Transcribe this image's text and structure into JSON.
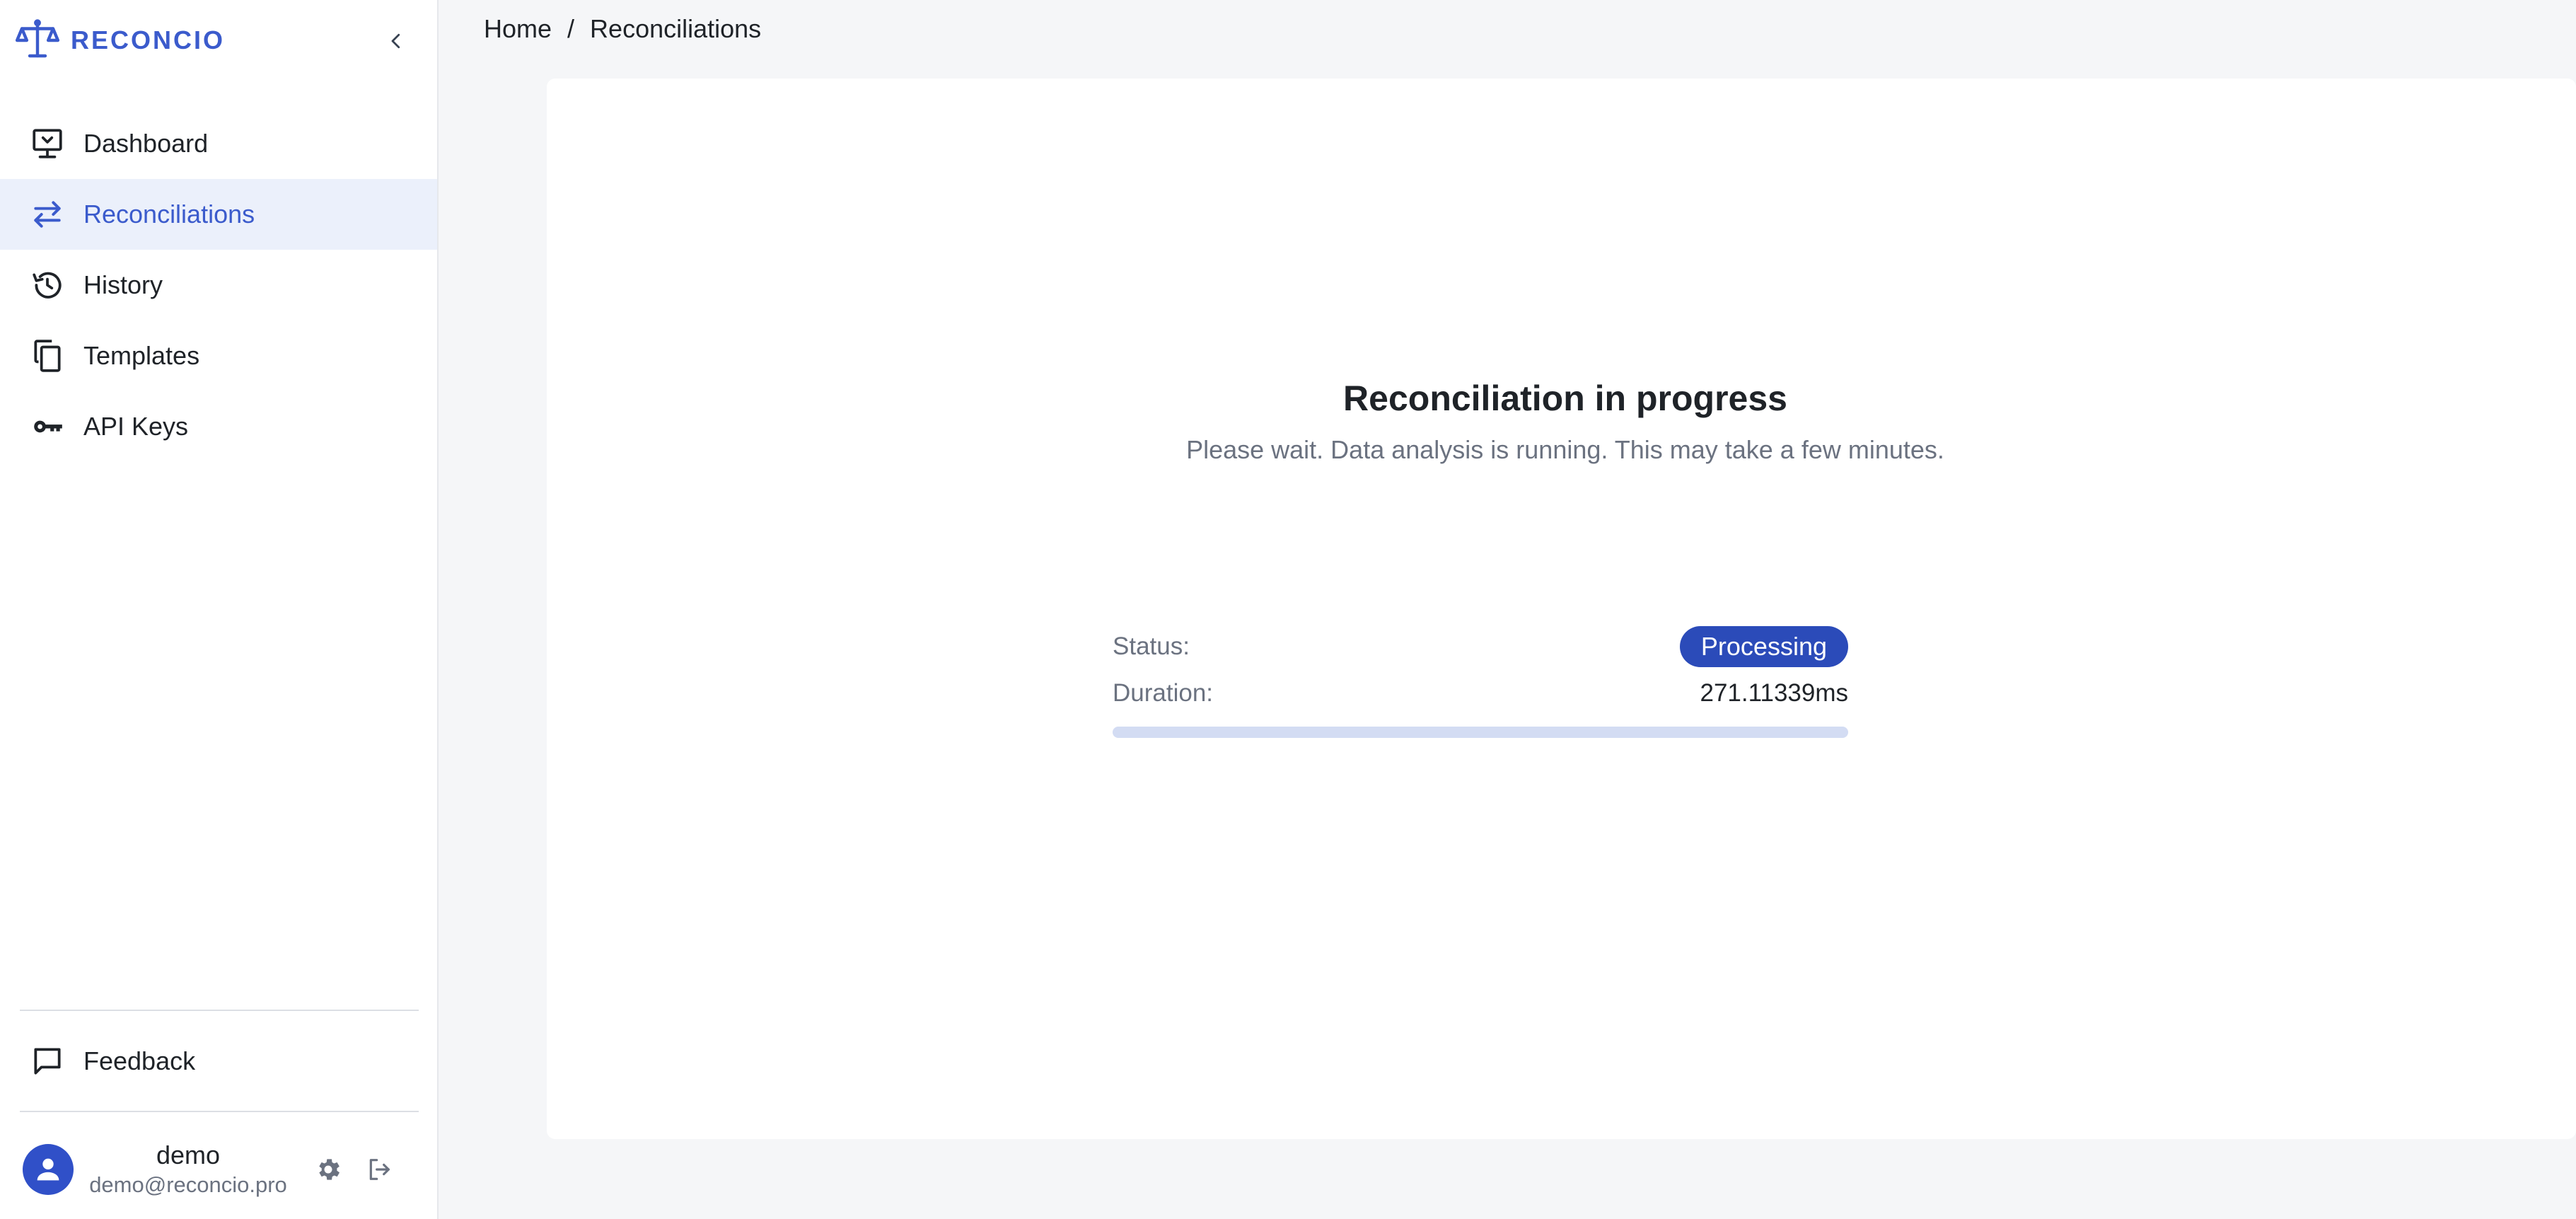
{
  "app": {
    "name": "RECONCIO"
  },
  "sidebar": {
    "items": [
      {
        "label": "Dashboard",
        "icon": "monitor-icon",
        "active": false
      },
      {
        "label": "Reconciliations",
        "icon": "swap-arrows-icon",
        "active": true
      },
      {
        "label": "History",
        "icon": "history-icon",
        "active": false
      },
      {
        "label": "Templates",
        "icon": "copy-icon",
        "active": false
      },
      {
        "label": "API Keys",
        "icon": "key-icon",
        "active": false
      }
    ],
    "feedback_label": "Feedback"
  },
  "user": {
    "name": "demo",
    "email": "demo@reconcio.pro"
  },
  "breadcrumb": {
    "home": "Home",
    "separator": "/",
    "current": "Reconciliations"
  },
  "progress": {
    "title": "Reconciliation in progress",
    "subtitle": "Please wait. Data analysis is running. This may take a few minutes.",
    "status_label": "Status:",
    "status_value": "Processing",
    "duration_label": "Duration:",
    "duration_value": "271.11339ms",
    "progress_fraction": 0.0
  },
  "colors": {
    "accent": "#3b5bcc",
    "badge": "#2b4bb9",
    "active_bg": "#ebf0fb",
    "track": "#d3dcf3"
  }
}
